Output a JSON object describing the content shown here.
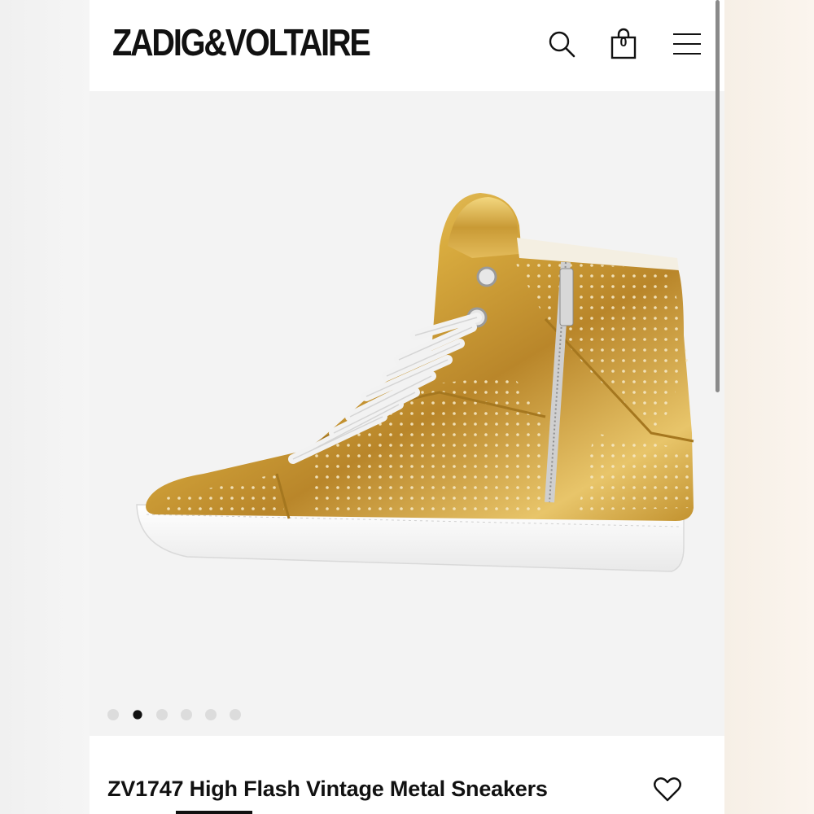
{
  "brand": {
    "logo_text": "ZADIG&VOLTAIRE"
  },
  "header": {
    "search_icon": "search-icon",
    "bag_icon": "shopping-bag-icon",
    "bag_count": "0",
    "menu_icon": "hamburger-menu-icon"
  },
  "gallery": {
    "image_subject": "gold metallic high-top sneaker with side zip",
    "total_images": 6,
    "active_index": 1
  },
  "product": {
    "title": "ZV1747 High Flash Vintage Metal Sneakers",
    "wishlist_icon": "heart-icon"
  },
  "colors": {
    "text": "#111111",
    "gallery_bg": "#f3f3f3",
    "gold": "#d4a93a",
    "dot_inactive": "#dcdcdc"
  }
}
